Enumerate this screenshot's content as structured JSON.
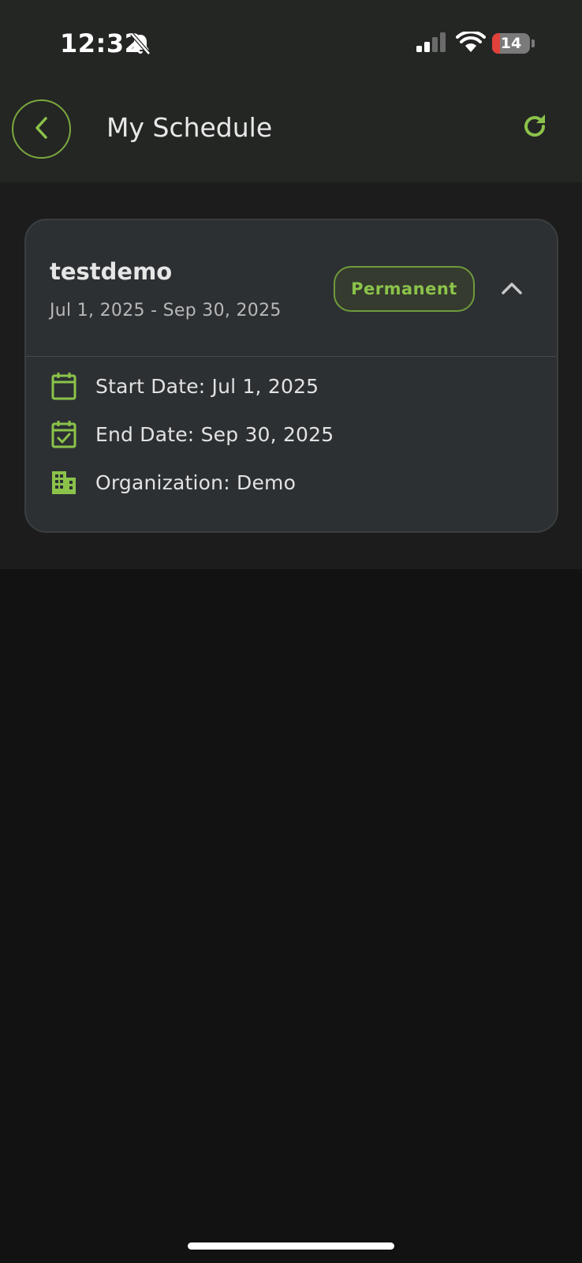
{
  "status_bar": {
    "time": "12:32",
    "battery_level": "14",
    "icons": [
      "bell-slash-icon",
      "cellular-signal-icon",
      "wifi-icon",
      "battery-icon"
    ]
  },
  "header": {
    "title": "My Schedule",
    "back_icon": "chevron-left-icon",
    "refresh_icon": "refresh-icon"
  },
  "schedule_card": {
    "name": "testdemo",
    "date_range": "Jul 1, 2025 - Sep 30, 2025",
    "badge": "Permanent",
    "expanded": true,
    "details": [
      {
        "icon": "calendar-icon",
        "label": "Start Date: Jul 1, 2025"
      },
      {
        "icon": "calendar-check-icon",
        "label": "End Date: Sep 30, 2025"
      },
      {
        "icon": "building-icon",
        "label": "Organization: Demo"
      }
    ]
  },
  "colors": {
    "accent": "#8bc34a",
    "header_bg": "#242624",
    "card_bg": "#2c3033",
    "page_bg": "#121212"
  }
}
